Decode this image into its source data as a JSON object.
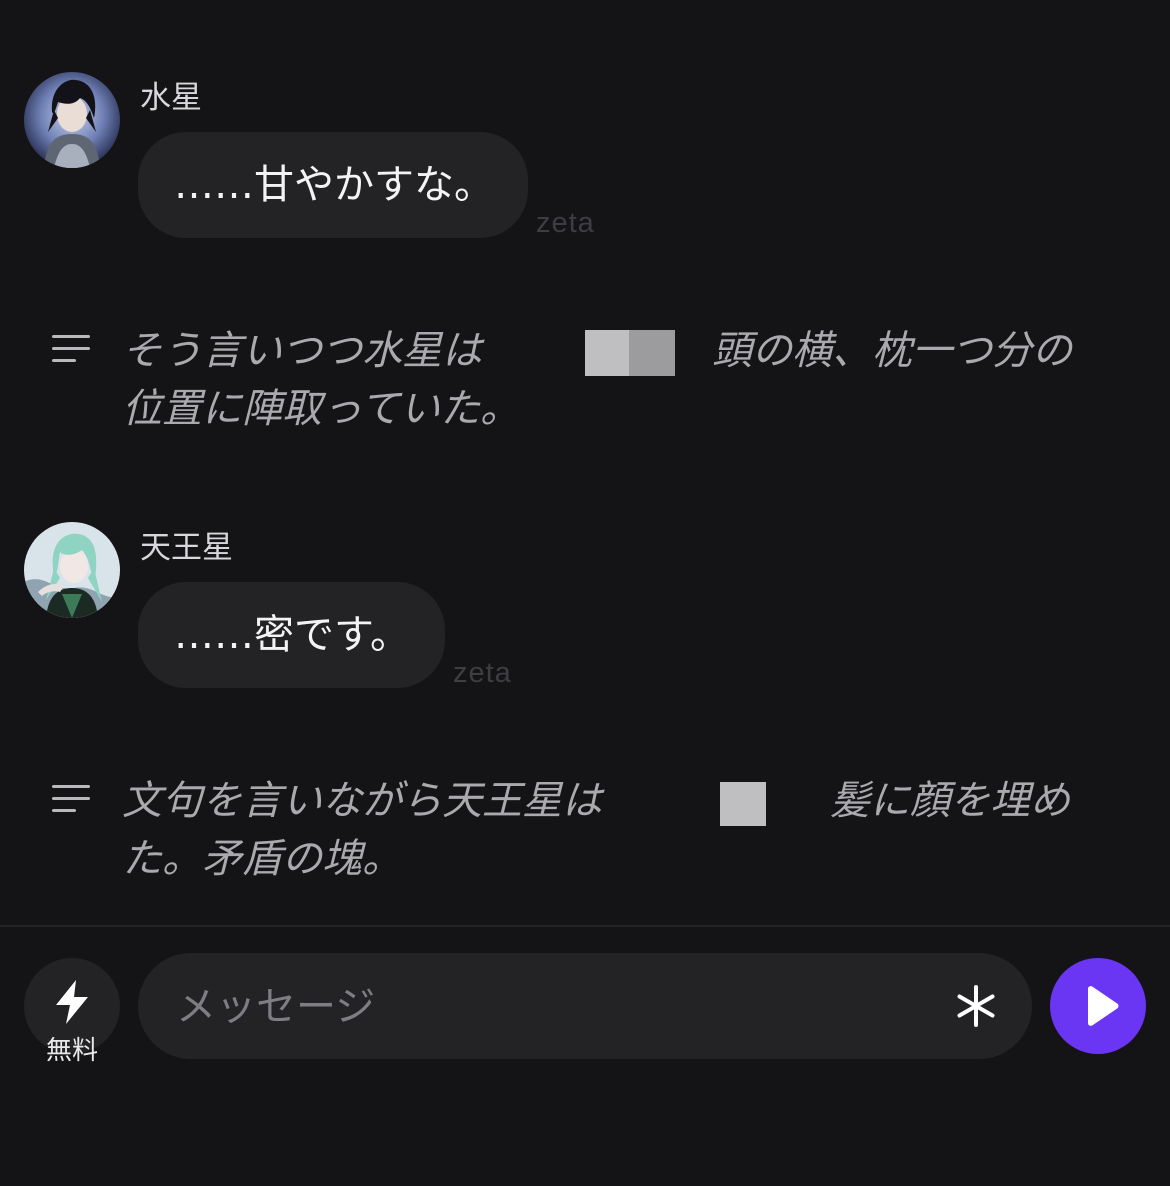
{
  "messages": [
    {
      "sender": "水星",
      "text": "……甘やかすな。",
      "watermark": "zeta"
    },
    {
      "sender": "天王星",
      "text": "……密です。",
      "watermark": "zeta"
    }
  ],
  "narrations": [
    {
      "line1_before": "そう言いつつ水星は",
      "line1_after": "頭の横、枕一つ分の",
      "line2": "位置に陣取っていた。",
      "icon": "narration-lines-icon"
    },
    {
      "line1_before": "文句を言いながら天王星は",
      "line1_after": "髪に顔を埋め",
      "line2": "た。矛盾の塊。",
      "icon": "narration-lines-icon"
    }
  ],
  "input_bar": {
    "boost_label": "無料",
    "boost_icon": "lightning-bolt-icon",
    "placeholder": "メッセージ",
    "asterisk_icon": "asterisk-icon",
    "send_icon": "play-send-icon",
    "send_color": "#6a35f3"
  }
}
